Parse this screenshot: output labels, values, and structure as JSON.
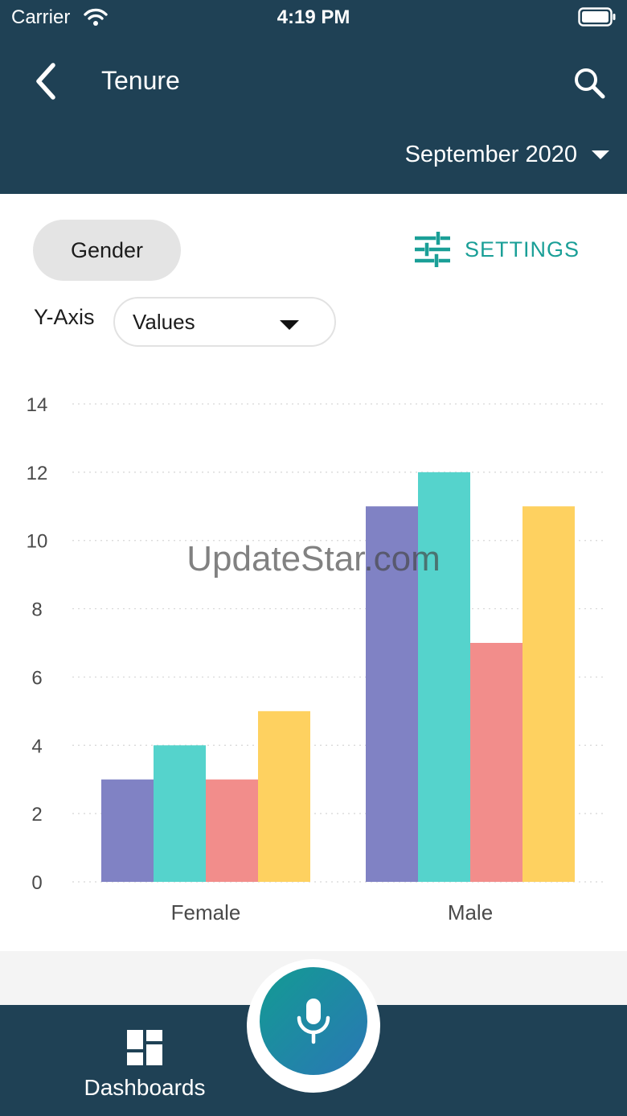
{
  "status_bar": {
    "carrier": "Carrier",
    "time": "4:19 PM"
  },
  "header": {
    "title": "Tenure",
    "period": "September 2020"
  },
  "icons": {
    "back": "chevron-left-icon",
    "search": "search-icon",
    "settings": "sliders-icon",
    "dashboards": "dashboard-grid-icon",
    "mic": "microphone-icon"
  },
  "filters": {
    "group_chip": "Gender",
    "settings_label": "SETTINGS",
    "yaxis_label": "Y-Axis",
    "yaxis_value": "Values"
  },
  "watermark": "UpdateStar.com",
  "chart_data": {
    "type": "bar",
    "categories": [
      "Female",
      "Male"
    ],
    "series": [
      {
        "values": [
          3,
          11
        ],
        "color": "#8082c4"
      },
      {
        "values": [
          4,
          12
        ],
        "color": "#55d3cc"
      },
      {
        "values": [
          3,
          7
        ],
        "color": "#f28d8b"
      },
      {
        "values": [
          5,
          11
        ],
        "color": "#fed160"
      }
    ],
    "ylim": [
      0,
      14
    ],
    "yticks": [
      0,
      2,
      4,
      6,
      8,
      10,
      12,
      14
    ],
    "grid": true
  },
  "tabbar": {
    "dashboards_label": "Dashboards"
  },
  "colors": {
    "header_bg": "#1f4155",
    "accent": "#1a9f97"
  }
}
